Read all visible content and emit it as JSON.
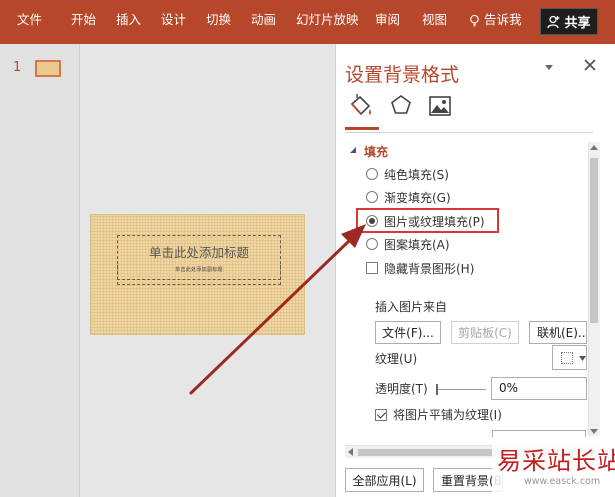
{
  "ribbon": {
    "tabs": [
      "文件",
      "开始",
      "插入",
      "设计",
      "切换",
      "动画",
      "幻灯片放映",
      "审阅",
      "视图"
    ],
    "tell_me": "告诉我",
    "share": "共享",
    "color": "#b7472a"
  },
  "thumbnails": {
    "slide_number": "1"
  },
  "slide": {
    "title_placeholder": "单击此处添加标题",
    "subtitle_placeholder": "单击此处添加副标题"
  },
  "pane": {
    "title": "设置背景格式",
    "section": "填充",
    "options": [
      {
        "label": "纯色填充(S)",
        "selected": false
      },
      {
        "label": "渐变填充(G)",
        "selected": false
      },
      {
        "label": "图片或纹理填充(P)",
        "selected": true
      },
      {
        "label": "图案填充(A)",
        "selected": false
      }
    ],
    "hide_bg": "隐藏背景图形(H)",
    "hide_bg_checked": false,
    "insert_from": "插入图片来自",
    "btn_file": "文件(F)...",
    "btn_clipboard": "剪贴板(C)",
    "btn_online": "联机(E)...",
    "texture_label": "纹理(U)",
    "transparency_label": "透明度(T)",
    "transparency": 0,
    "transparency_value": "0%",
    "tile_label": "将图片平铺为纹理(I)",
    "tile_checked": true,
    "apply_all": "全部应用(L)",
    "reset_bg": "重置背景(B)"
  },
  "watermark": {
    "text": "易采站长站",
    "url": "www.easck.com"
  }
}
